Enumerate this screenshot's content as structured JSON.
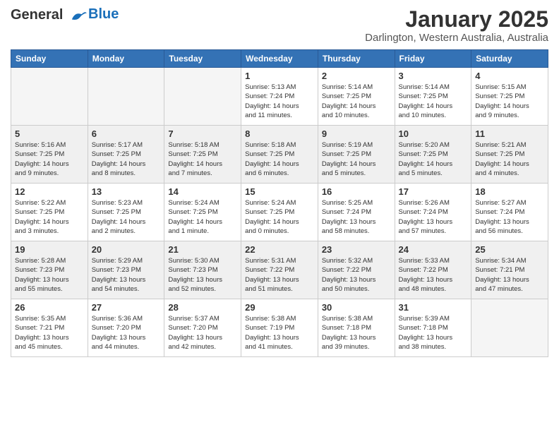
{
  "header": {
    "logo_line1": "General",
    "logo_line2": "Blue",
    "month": "January 2025",
    "location": "Darlington, Western Australia, Australia"
  },
  "weekdays": [
    "Sunday",
    "Monday",
    "Tuesday",
    "Wednesday",
    "Thursday",
    "Friday",
    "Saturday"
  ],
  "weeks": [
    [
      {
        "day": "",
        "info": ""
      },
      {
        "day": "",
        "info": ""
      },
      {
        "day": "",
        "info": ""
      },
      {
        "day": "1",
        "info": "Sunrise: 5:13 AM\nSunset: 7:24 PM\nDaylight: 14 hours\nand 11 minutes."
      },
      {
        "day": "2",
        "info": "Sunrise: 5:14 AM\nSunset: 7:25 PM\nDaylight: 14 hours\nand 10 minutes."
      },
      {
        "day": "3",
        "info": "Sunrise: 5:14 AM\nSunset: 7:25 PM\nDaylight: 14 hours\nand 10 minutes."
      },
      {
        "day": "4",
        "info": "Sunrise: 5:15 AM\nSunset: 7:25 PM\nDaylight: 14 hours\nand 9 minutes."
      }
    ],
    [
      {
        "day": "5",
        "info": "Sunrise: 5:16 AM\nSunset: 7:25 PM\nDaylight: 14 hours\nand 9 minutes."
      },
      {
        "day": "6",
        "info": "Sunrise: 5:17 AM\nSunset: 7:25 PM\nDaylight: 14 hours\nand 8 minutes."
      },
      {
        "day": "7",
        "info": "Sunrise: 5:18 AM\nSunset: 7:25 PM\nDaylight: 14 hours\nand 7 minutes."
      },
      {
        "day": "8",
        "info": "Sunrise: 5:18 AM\nSunset: 7:25 PM\nDaylight: 14 hours\nand 6 minutes."
      },
      {
        "day": "9",
        "info": "Sunrise: 5:19 AM\nSunset: 7:25 PM\nDaylight: 14 hours\nand 5 minutes."
      },
      {
        "day": "10",
        "info": "Sunrise: 5:20 AM\nSunset: 7:25 PM\nDaylight: 14 hours\nand 5 minutes."
      },
      {
        "day": "11",
        "info": "Sunrise: 5:21 AM\nSunset: 7:25 PM\nDaylight: 14 hours\nand 4 minutes."
      }
    ],
    [
      {
        "day": "12",
        "info": "Sunrise: 5:22 AM\nSunset: 7:25 PM\nDaylight: 14 hours\nand 3 minutes."
      },
      {
        "day": "13",
        "info": "Sunrise: 5:23 AM\nSunset: 7:25 PM\nDaylight: 14 hours\nand 2 minutes."
      },
      {
        "day": "14",
        "info": "Sunrise: 5:24 AM\nSunset: 7:25 PM\nDaylight: 14 hours\nand 1 minute."
      },
      {
        "day": "15",
        "info": "Sunrise: 5:24 AM\nSunset: 7:25 PM\nDaylight: 14 hours\nand 0 minutes."
      },
      {
        "day": "16",
        "info": "Sunrise: 5:25 AM\nSunset: 7:24 PM\nDaylight: 13 hours\nand 58 minutes."
      },
      {
        "day": "17",
        "info": "Sunrise: 5:26 AM\nSunset: 7:24 PM\nDaylight: 13 hours\nand 57 minutes."
      },
      {
        "day": "18",
        "info": "Sunrise: 5:27 AM\nSunset: 7:24 PM\nDaylight: 13 hours\nand 56 minutes."
      }
    ],
    [
      {
        "day": "19",
        "info": "Sunrise: 5:28 AM\nSunset: 7:23 PM\nDaylight: 13 hours\nand 55 minutes."
      },
      {
        "day": "20",
        "info": "Sunrise: 5:29 AM\nSunset: 7:23 PM\nDaylight: 13 hours\nand 54 minutes."
      },
      {
        "day": "21",
        "info": "Sunrise: 5:30 AM\nSunset: 7:23 PM\nDaylight: 13 hours\nand 52 minutes."
      },
      {
        "day": "22",
        "info": "Sunrise: 5:31 AM\nSunset: 7:22 PM\nDaylight: 13 hours\nand 51 minutes."
      },
      {
        "day": "23",
        "info": "Sunrise: 5:32 AM\nSunset: 7:22 PM\nDaylight: 13 hours\nand 50 minutes."
      },
      {
        "day": "24",
        "info": "Sunrise: 5:33 AM\nSunset: 7:22 PM\nDaylight: 13 hours\nand 48 minutes."
      },
      {
        "day": "25",
        "info": "Sunrise: 5:34 AM\nSunset: 7:21 PM\nDaylight: 13 hours\nand 47 minutes."
      }
    ],
    [
      {
        "day": "26",
        "info": "Sunrise: 5:35 AM\nSunset: 7:21 PM\nDaylight: 13 hours\nand 45 minutes."
      },
      {
        "day": "27",
        "info": "Sunrise: 5:36 AM\nSunset: 7:20 PM\nDaylight: 13 hours\nand 44 minutes."
      },
      {
        "day": "28",
        "info": "Sunrise: 5:37 AM\nSunset: 7:20 PM\nDaylight: 13 hours\nand 42 minutes."
      },
      {
        "day": "29",
        "info": "Sunrise: 5:38 AM\nSunset: 7:19 PM\nDaylight: 13 hours\nand 41 minutes."
      },
      {
        "day": "30",
        "info": "Sunrise: 5:38 AM\nSunset: 7:18 PM\nDaylight: 13 hours\nand 39 minutes."
      },
      {
        "day": "31",
        "info": "Sunrise: 5:39 AM\nSunset: 7:18 PM\nDaylight: 13 hours\nand 38 minutes."
      },
      {
        "day": "",
        "info": ""
      }
    ]
  ]
}
